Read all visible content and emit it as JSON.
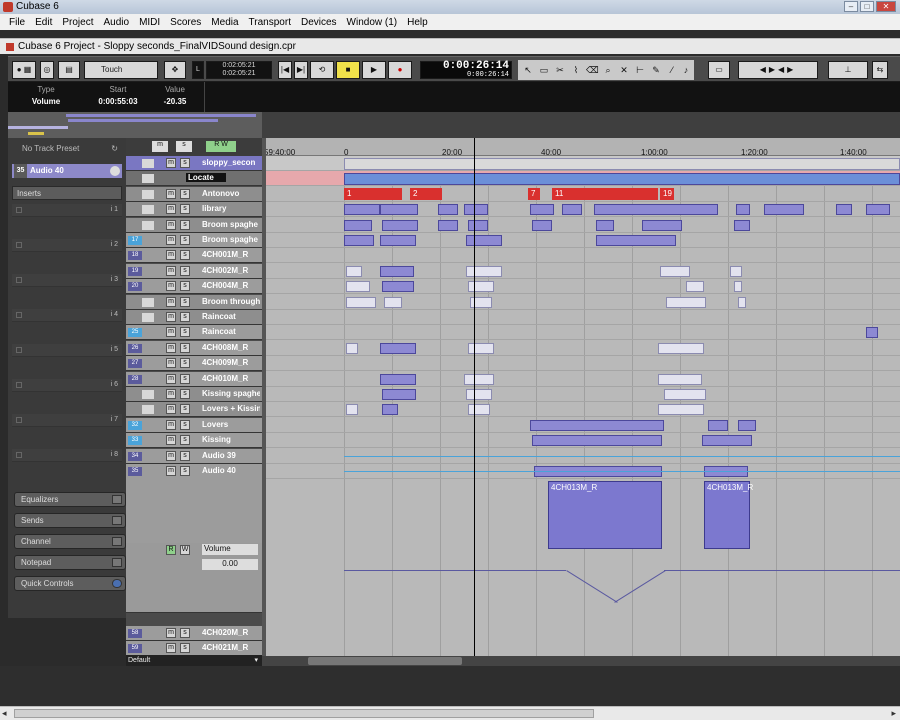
{
  "window": {
    "title": "Cubase 6"
  },
  "menu": [
    "File",
    "Edit",
    "Project",
    "Audio",
    "MIDI",
    "Scores",
    "Media",
    "Transport",
    "Devices",
    "Window (1)",
    "Help"
  ],
  "project": {
    "title": "Cubase 6 Project - Sloppy seconds_FinalVIDSound design.cpr"
  },
  "toolbar": {
    "automation_mode": "Touch",
    "left_locator": "0:02:05:21",
    "right_locator": "0:02:05:21",
    "primary_time": "0:00:26:14",
    "secondary_time": "0:00:26:14"
  },
  "infoline": {
    "type_label": "Type",
    "type_value": "Volume",
    "start_label": "Start",
    "start_value": "0:00:55:03",
    "value_label": "Value",
    "value_value": "-20.35"
  },
  "inspector": {
    "preset": "No Track Preset",
    "track_num": "35",
    "track_name": "Audio 40",
    "inserts": "Inserts",
    "slots": [
      "i 1",
      "i 2",
      "i 3",
      "i 4",
      "i 5",
      "i 6",
      "i 7",
      "i 8"
    ],
    "sections": [
      "Equalizers",
      "Sends",
      "Channel",
      "Notepad",
      "Quick Controls"
    ]
  },
  "ruler": [
    "59:40:00",
    "0",
    "20:00",
    "40:00",
    "1:00:00",
    "1:20:00",
    "1:40:00"
  ],
  "markers": [
    {
      "label": "1"
    },
    {
      "label": "2"
    },
    {
      "label": "7"
    },
    {
      "label": "11"
    },
    {
      "label": "19"
    }
  ],
  "tracks": [
    {
      "num": "",
      "name": "sloppy_secon"
    },
    {
      "num": "",
      "name": "Locate"
    },
    {
      "num": "",
      "name": "Antonovo"
    },
    {
      "num": "",
      "name": "library"
    },
    {
      "num": "",
      "name": "Broom spaghe"
    },
    {
      "num": "17",
      "name": "Broom spaghe"
    },
    {
      "num": "18",
      "name": "4CH001M_R"
    },
    {
      "num": "19",
      "name": "4CH002M_R"
    },
    {
      "num": "20",
      "name": "4CH004M_R"
    },
    {
      "num": "",
      "name": "Broom through"
    },
    {
      "num": "",
      "name": "Raincoat"
    },
    {
      "num": "25",
      "name": "Raincoat"
    },
    {
      "num": "26",
      "name": "4CH008M_R"
    },
    {
      "num": "27",
      "name": "4CH009M_R"
    },
    {
      "num": "28",
      "name": "4CH010M_R"
    },
    {
      "num": "",
      "name": "Kissing spaghett"
    },
    {
      "num": "",
      "name": "Lovers + Kissin"
    },
    {
      "num": "32",
      "name": "Lovers"
    },
    {
      "num": "33",
      "name": "Kissing"
    },
    {
      "num": "34",
      "name": "Audio 39"
    },
    {
      "num": "35",
      "name": "Audio 40"
    }
  ],
  "automation": {
    "param": "Volume",
    "value": "0.00"
  },
  "bottom_tracks": [
    {
      "num": "58",
      "name": "4CH020M_R"
    },
    {
      "num": "59",
      "name": "4CH021M_R"
    }
  ],
  "clip_names": {
    "big1": "4CH013M_R",
    "big2": "4CH013M_R"
  },
  "footer": {
    "default_label": "Default"
  }
}
